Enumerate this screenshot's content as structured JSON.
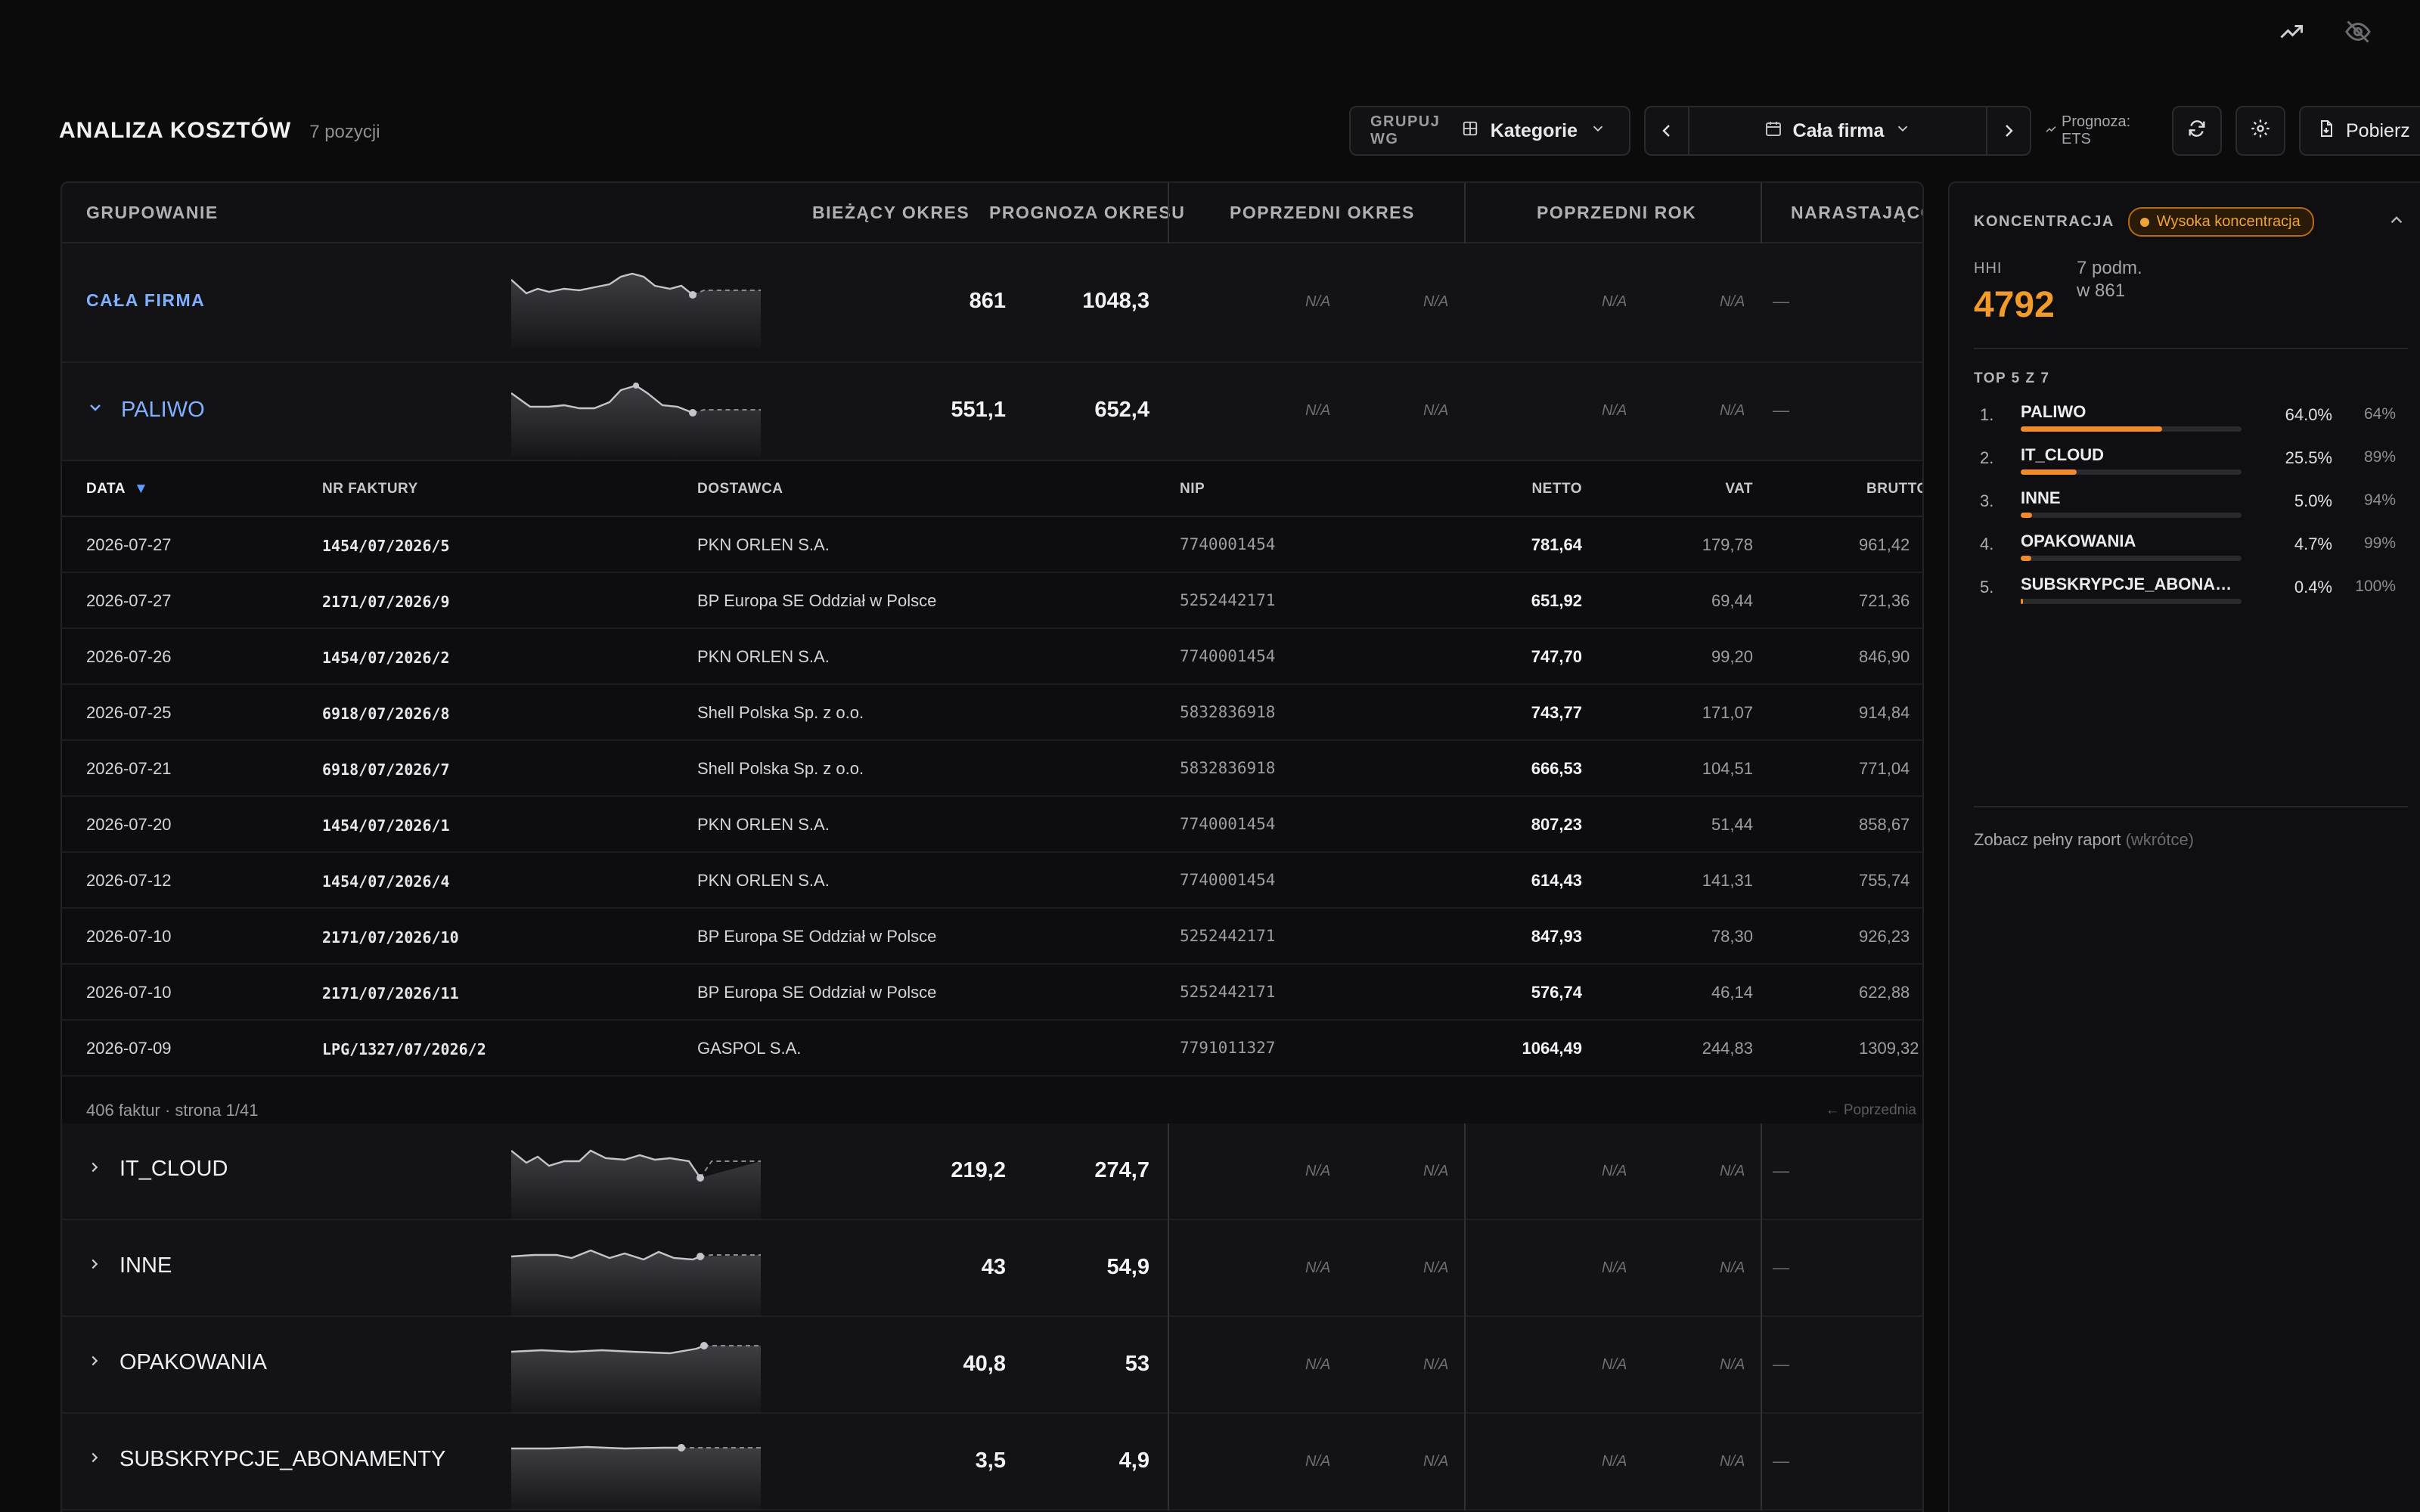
{
  "header": {
    "title": "ANALIZA KOSZTÓW",
    "count": "7 pozycji",
    "group_label": "GRUPUJ WG",
    "group_value": "Kategorie",
    "period_value": "Cała firma",
    "forecast": "Prognoza: ETS",
    "download": "Pobierz"
  },
  "table": {
    "columns": {
      "grouping": "GRUPOWANIE",
      "current": "BIEŻĄCY OKRES",
      "forecast": "PROGNOZA OKRESU",
      "prev_period": "POPRZEDNI OKRES",
      "prev_year": "POPRZEDNI ROK",
      "cumulative": "NARASTAJĄCO"
    },
    "na": "N/A",
    "dash": "—",
    "groups": [
      {
        "name": "CAŁA FIRMA",
        "current": "861",
        "forecast": "1048,3"
      },
      {
        "name": "PALIWO",
        "current": "551,1",
        "forecast": "652,4"
      },
      {
        "name": "IT_CLOUD",
        "current": "219,2",
        "forecast": "274,7"
      },
      {
        "name": "INNE",
        "current": "43",
        "forecast": "54,9"
      },
      {
        "name": "OPAKOWANIA",
        "current": "40,8",
        "forecast": "53"
      },
      {
        "name": "SUBSKRYPCJE_ABONAMENTY",
        "current": "3,5",
        "forecast": "4,9"
      }
    ]
  },
  "detail": {
    "columns": {
      "date": "DATA",
      "invoice": "NR FAKTURY",
      "supplier": "DOSTAWCA",
      "nip": "NIP",
      "net": "NETTO",
      "vat": "VAT",
      "gross": "BRUTTO"
    },
    "rows": [
      {
        "date": "2026-07-27",
        "invoice": "1454/07/2026/5",
        "supplier": "PKN ORLEN S.A.",
        "nip": "7740001454",
        "net": "781,64",
        "vat": "179,78",
        "gross": "961,42"
      },
      {
        "date": "2026-07-27",
        "invoice": "2171/07/2026/9",
        "supplier": "BP Europa SE Oddział w Polsce",
        "nip": "5252442171",
        "net": "651,92",
        "vat": "69,44",
        "gross": "721,36"
      },
      {
        "date": "2026-07-26",
        "invoice": "1454/07/2026/2",
        "supplier": "PKN ORLEN S.A.",
        "nip": "7740001454",
        "net": "747,70",
        "vat": "99,20",
        "gross": "846,90"
      },
      {
        "date": "2026-07-25",
        "invoice": "6918/07/2026/8",
        "supplier": "Shell Polska Sp. z o.o.",
        "nip": "5832836918",
        "net": "743,77",
        "vat": "171,07",
        "gross": "914,84"
      },
      {
        "date": "2026-07-21",
        "invoice": "6918/07/2026/7",
        "supplier": "Shell Polska Sp. z o.o.",
        "nip": "5832836918",
        "net": "666,53",
        "vat": "104,51",
        "gross": "771,04"
      },
      {
        "date": "2026-07-20",
        "invoice": "1454/07/2026/1",
        "supplier": "PKN ORLEN S.A.",
        "nip": "7740001454",
        "net": "807,23",
        "vat": "51,44",
        "gross": "858,67"
      },
      {
        "date": "2026-07-12",
        "invoice": "1454/07/2026/4",
        "supplier": "PKN ORLEN S.A.",
        "nip": "7740001454",
        "net": "614,43",
        "vat": "141,31",
        "gross": "755,74"
      },
      {
        "date": "2026-07-10",
        "invoice": "2171/07/2026/10",
        "supplier": "BP Europa SE Oddział w Polsce",
        "nip": "5252442171",
        "net": "847,93",
        "vat": "78,30",
        "gross": "926,23"
      },
      {
        "date": "2026-07-10",
        "invoice": "2171/07/2026/11",
        "supplier": "BP Europa SE Oddział w Polsce",
        "nip": "5252442171",
        "net": "576,74",
        "vat": "46,14",
        "gross": "622,88"
      },
      {
        "date": "2026-07-09",
        "invoice": "LPG/1327/07/2026/2",
        "supplier": "GASPOL S.A.",
        "nip": "7791011327",
        "net": "1064,49",
        "vat": "244,83",
        "gross": "1309,32"
      }
    ],
    "pager_info": "406 faktur · strona 1/41",
    "pager_prev": "← Poprzednia"
  },
  "panel": {
    "title": "KONCENTRACJA",
    "badge": "Wysoka koncentracja",
    "hhi_label": "HHI",
    "hhi_value": "4792",
    "hhi_sub1": "7 podm.",
    "hhi_sub2": "w 861",
    "top_label": "TOP 5 Z 7",
    "items": [
      {
        "idx": "1.",
        "name": "PALIWO",
        "pct": "64.0%",
        "cum": "64%",
        "share": 0.64
      },
      {
        "idx": "2.",
        "name": "IT_CLOUD",
        "pct": "25.5%",
        "cum": "89%",
        "share": 0.255
      },
      {
        "idx": "3.",
        "name": "INNE",
        "pct": "5.0%",
        "cum": "94%",
        "share": 0.05
      },
      {
        "idx": "4.",
        "name": "OPAKOWANIA",
        "pct": "4.7%",
        "cum": "99%",
        "share": 0.047
      },
      {
        "idx": "5.",
        "name": "SUBSKRYPCJE_ABONAMENTY",
        "pct": "0.4%",
        "cum": "100%",
        "share": 0.004
      }
    ],
    "report": "Zobacz pełny raport",
    "report_soon": "(wkrótce)"
  },
  "colors": {
    "accent": "#f29a2a",
    "link": "#7fb1ff"
  }
}
